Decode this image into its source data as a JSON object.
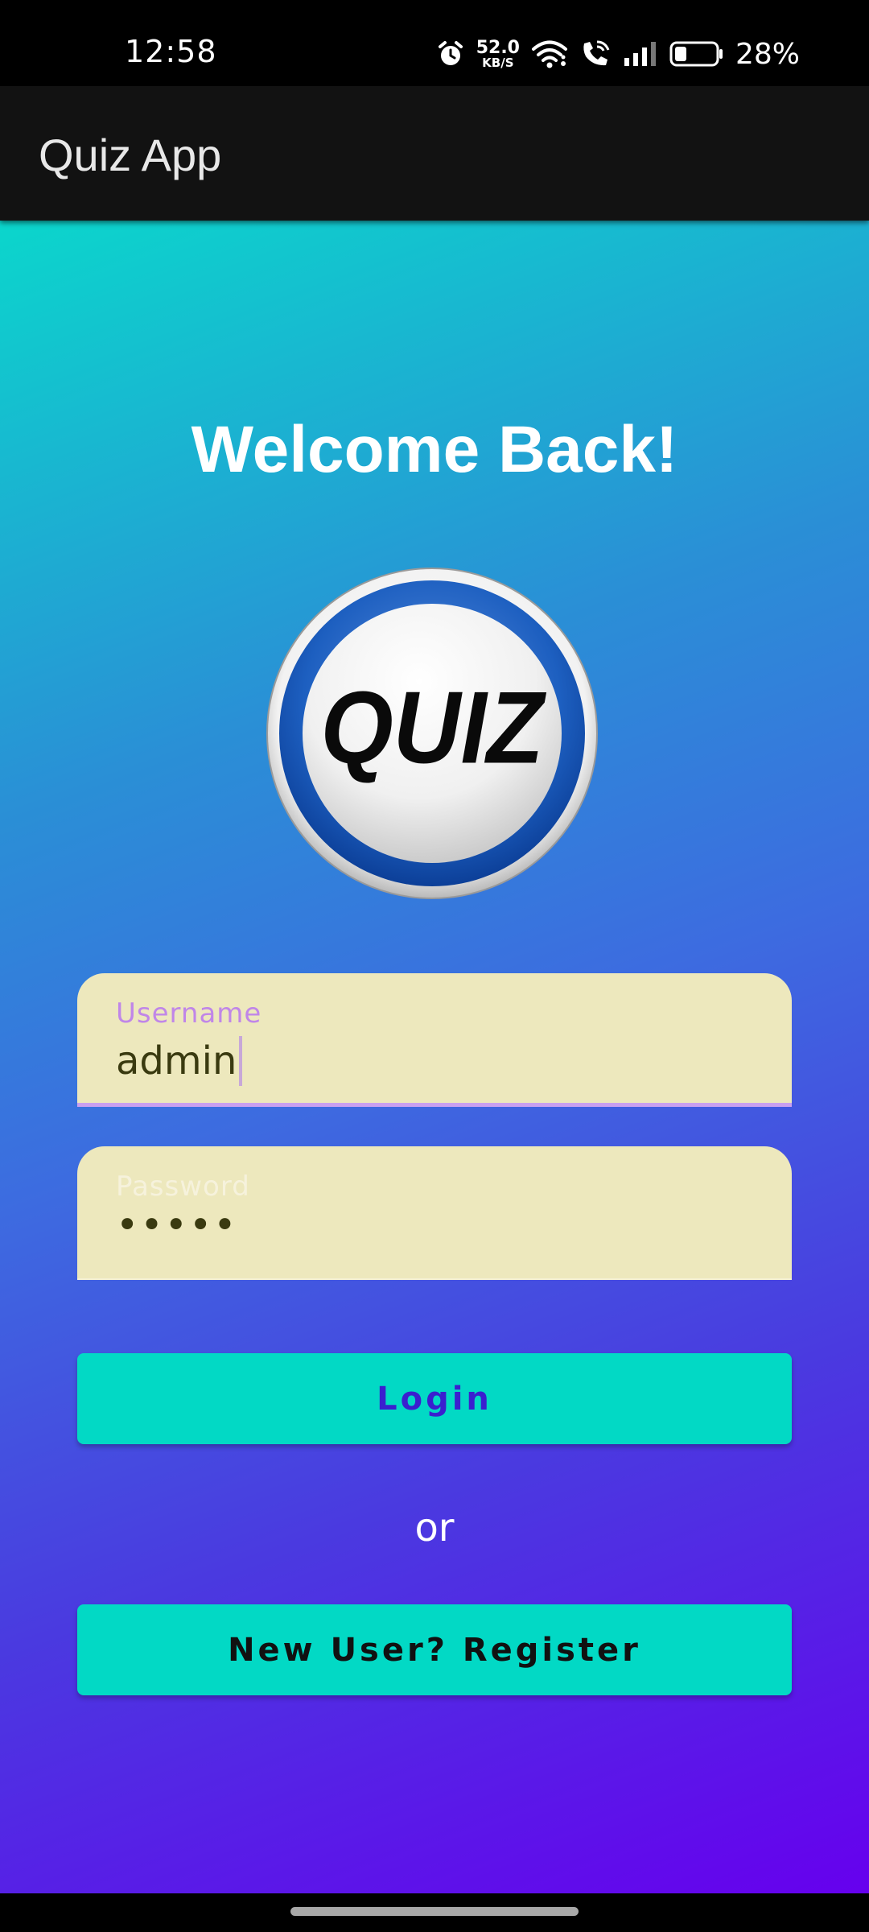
{
  "status_bar": {
    "time": "12:58",
    "net_speed_value": "52.0",
    "net_speed_unit": "KB/S",
    "battery_percent": "28%",
    "icons": [
      "alarm-icon",
      "wifi-icon",
      "wifi-call-icon",
      "signal-icon",
      "battery-icon"
    ]
  },
  "app_bar": {
    "title": "Quiz App"
  },
  "main": {
    "welcome": "Welcome Back!",
    "logo_text": "QUIZ",
    "username": {
      "label": "Username",
      "value": "admin"
    },
    "password": {
      "label": "Password",
      "value": "•••••"
    },
    "login_label": "Login",
    "or_text": "or",
    "register_label": "New User? Register"
  },
  "colors": {
    "button": "#02d9c5",
    "field_bg": "#ede8bd",
    "focus_accent": "#c086e8",
    "login_text": "#3a1fcf",
    "gradient_start": "#0bd6cc",
    "gradient_end": "#6600ee"
  }
}
